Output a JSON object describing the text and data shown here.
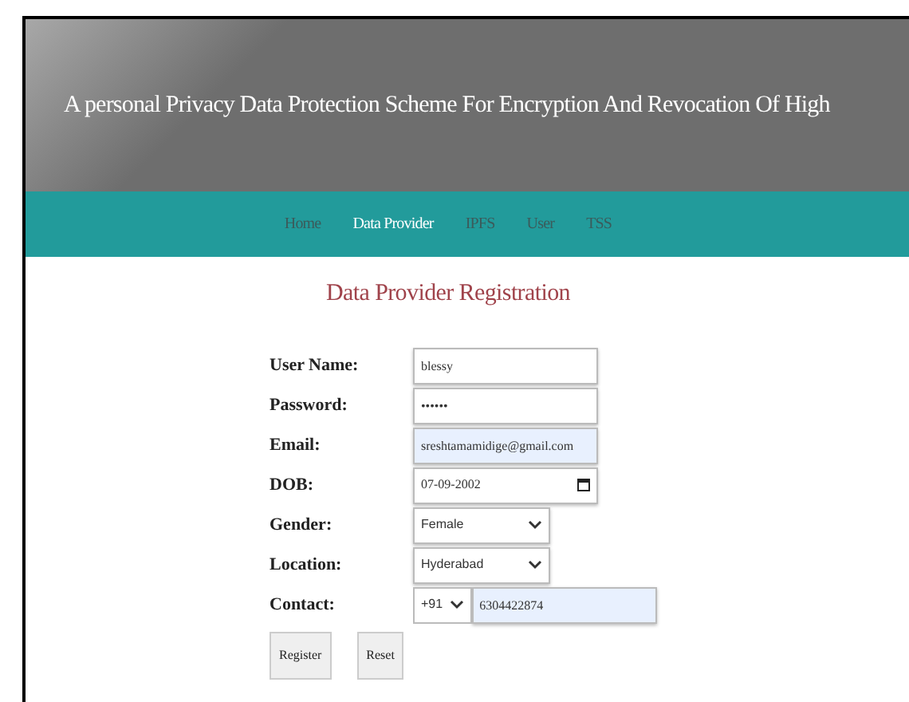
{
  "header": {
    "title": "A personal Privacy Data Protection Scheme For Encryption And Revocation Of High"
  },
  "nav": [
    {
      "label": "Home",
      "selected": false
    },
    {
      "label": "Data Provider",
      "selected": true
    },
    {
      "label": "IPFS",
      "selected": false
    },
    {
      "label": "User",
      "selected": false
    },
    {
      "label": "TSS",
      "selected": false
    }
  ],
  "form": {
    "heading": "Data Provider Registration",
    "fields": [
      {
        "label": "User Name:",
        "kind": "text",
        "value": "blessy",
        "autofilled": false
      },
      {
        "label": "Password:",
        "kind": "text",
        "value": "••••••",
        "autofilled": false
      },
      {
        "label": "Email:",
        "kind": "text",
        "value": "sreshtamamidige@gmail.com",
        "autofilled": true
      },
      {
        "label": "DOB:",
        "kind": "date",
        "value": "07-09-2002",
        "autofilled": false
      },
      {
        "label": "Gender:",
        "kind": "select",
        "value": "Female",
        "autofilled": false
      },
      {
        "label": "Location:",
        "kind": "select",
        "value": "Hyderabad",
        "autofilled": false
      },
      {
        "label": "Contact:",
        "kind": "phone",
        "code": "+91",
        "value": "6304422874",
        "autofilled": true
      }
    ],
    "buttons": [
      "Register",
      "Reset"
    ]
  }
}
